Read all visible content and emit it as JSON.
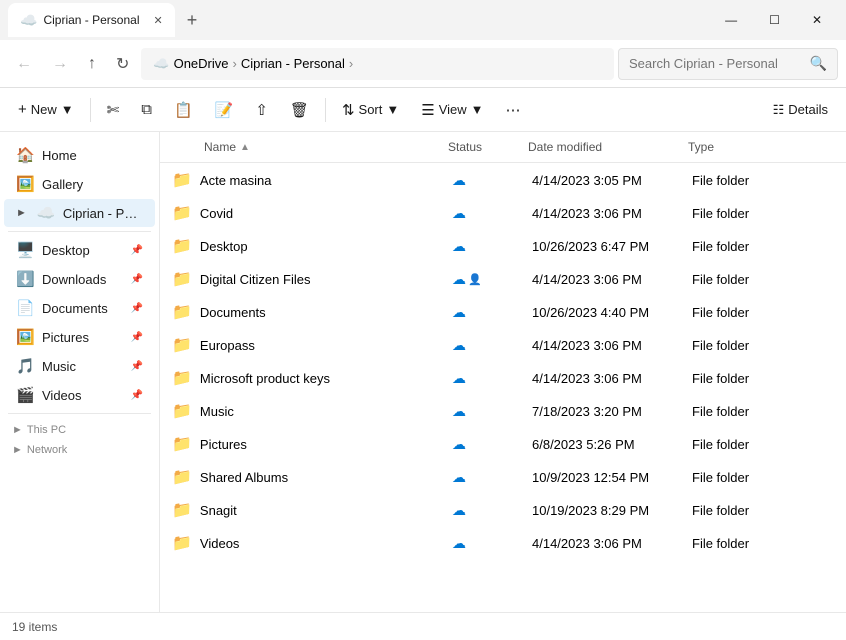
{
  "titlebar": {
    "tab_title": "Ciprian - Personal",
    "new_tab_btn": "+",
    "win_min": "—",
    "win_max": "☐",
    "win_close": "✕"
  },
  "navbar": {
    "back_title": "Back",
    "forward_title": "Forward",
    "up_title": "Up",
    "refresh_title": "Refresh",
    "breadcrumb": [
      {
        "label": "OneDrive",
        "is_cloud": true
      },
      {
        "label": "Ciprian - Personal"
      }
    ],
    "search_placeholder": "Search Ciprian - Personal"
  },
  "toolbar": {
    "new_label": "New",
    "cut_title": "Cut",
    "copy_title": "Copy",
    "paste_title": "Paste",
    "rename_title": "Rename",
    "share_title": "Share",
    "delete_title": "Delete",
    "sort_label": "Sort",
    "view_label": "View",
    "more_title": "More",
    "details_label": "Details"
  },
  "sidebar": {
    "items": [
      {
        "id": "home",
        "label": "Home",
        "icon": "🏠",
        "pinned": false,
        "active": false
      },
      {
        "id": "gallery",
        "label": "Gallery",
        "icon": "🖼️",
        "pinned": false,
        "active": false
      },
      {
        "id": "ciprian",
        "label": "Ciprian - Personal",
        "icon": "☁️",
        "pinned": false,
        "active": true
      },
      {
        "id": "desktop",
        "label": "Desktop",
        "icon": "🖥️",
        "pinned": true,
        "active": false
      },
      {
        "id": "downloads",
        "label": "Downloads",
        "icon": "⬇️",
        "pinned": true,
        "active": false
      },
      {
        "id": "documents",
        "label": "Documents",
        "icon": "📄",
        "pinned": true,
        "active": false
      },
      {
        "id": "pictures",
        "label": "Pictures",
        "icon": "🖼️",
        "pinned": true,
        "active": false
      },
      {
        "id": "music",
        "label": "Music",
        "icon": "🎵",
        "pinned": true,
        "active": false
      },
      {
        "id": "videos",
        "label": "Videos",
        "icon": "🎬",
        "pinned": true,
        "active": false
      }
    ],
    "sections": [
      {
        "id": "thispc",
        "label": "This PC"
      },
      {
        "id": "network",
        "label": "Network"
      }
    ]
  },
  "filelist": {
    "columns": [
      {
        "id": "name",
        "label": "Name",
        "sort_arrow": "▲"
      },
      {
        "id": "status",
        "label": "Status"
      },
      {
        "id": "date",
        "label": "Date modified"
      },
      {
        "id": "type",
        "label": "Type"
      }
    ],
    "rows": [
      {
        "name": "Acte masina",
        "status": "cloud",
        "date": "4/14/2023 3:05 PM",
        "type": "File folder",
        "shared": false
      },
      {
        "name": "Covid",
        "status": "cloud",
        "date": "4/14/2023 3:06 PM",
        "type": "File folder",
        "shared": false
      },
      {
        "name": "Desktop",
        "status": "cloud",
        "date": "10/26/2023 6:47 PM",
        "type": "File folder",
        "shared": false
      },
      {
        "name": "Digital Citizen Files",
        "status": "cloud_shared",
        "date": "4/14/2023 3:06 PM",
        "type": "File folder",
        "shared": true
      },
      {
        "name": "Documents",
        "status": "cloud",
        "date": "10/26/2023 4:40 PM",
        "type": "File folder",
        "shared": false
      },
      {
        "name": "Europass",
        "status": "cloud",
        "date": "4/14/2023 3:06 PM",
        "type": "File folder",
        "shared": false
      },
      {
        "name": "Microsoft product keys",
        "status": "cloud",
        "date": "4/14/2023 3:06 PM",
        "type": "File folder",
        "shared": false
      },
      {
        "name": "Music",
        "status": "cloud",
        "date": "7/18/2023 3:20 PM",
        "type": "File folder",
        "shared": false
      },
      {
        "name": "Pictures",
        "status": "cloud",
        "date": "6/8/2023 5:26 PM",
        "type": "File folder",
        "shared": false
      },
      {
        "name": "Shared Albums",
        "status": "cloud",
        "date": "10/9/2023 12:54 PM",
        "type": "File folder",
        "shared": false
      },
      {
        "name": "Snagit",
        "status": "cloud",
        "date": "10/19/2023 8:29 PM",
        "type": "File folder",
        "shared": false
      },
      {
        "name": "Videos",
        "status": "cloud",
        "date": "4/14/2023 3:06 PM",
        "type": "File folder",
        "shared": false
      }
    ]
  },
  "statusbar": {
    "items_count": "19 items"
  }
}
